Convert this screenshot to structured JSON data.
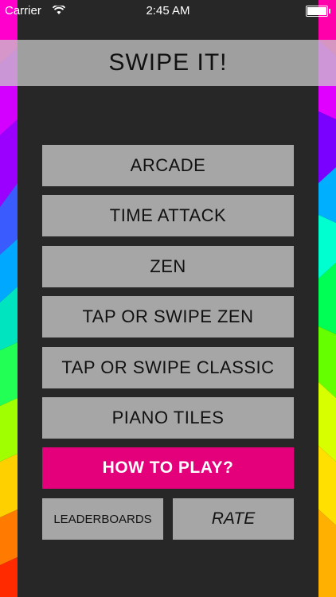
{
  "status_bar": {
    "carrier": "Carrier",
    "time": "2:45 AM",
    "wifi_icon": "wifi-icon",
    "battery_icon": "battery-icon"
  },
  "title": "SWIPE IT!",
  "menu": {
    "arcade": "ARCADE",
    "time_attack": "TIME ATTACK",
    "zen": "ZEN",
    "tap_or_swipe_zen": "TAP OR SWIPE ZEN",
    "tap_or_swipe_classic": "TAP OR SWIPE CLASSIC",
    "piano_tiles": "PIANO TILES",
    "how_to_play": "HOW TO PLAY?",
    "leaderboards": "LEADERBOARDS",
    "rate": "RATE"
  },
  "colors": {
    "panel": "#272727",
    "button": "#a6a6a6",
    "accent": "#e4007a",
    "title_bar": "#c8c8c8"
  }
}
